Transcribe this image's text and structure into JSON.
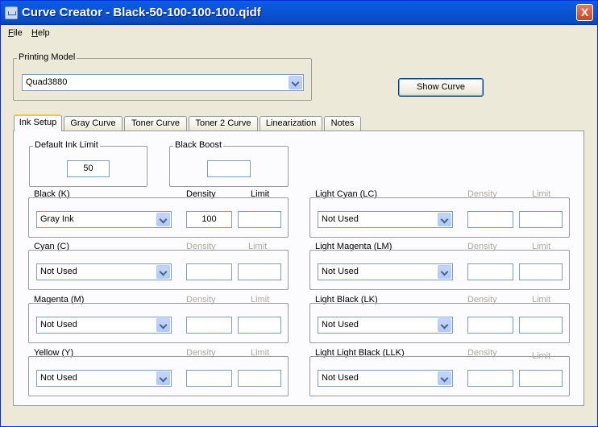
{
  "window": {
    "title": "Curve Creator - Black-50-100-100-100.qidf",
    "close_label": "X"
  },
  "menu": {
    "file_u": "F",
    "file_rest": "ile",
    "help_u": "H",
    "help_rest": "elp"
  },
  "printing_model": {
    "label": "Printing Model",
    "value": "Quad3880"
  },
  "show_curve_label": "Show Curve",
  "tabs": [
    "Ink Setup",
    "Gray Curve",
    "Toner Curve",
    "Toner 2 Curve",
    "Linearization",
    "Notes"
  ],
  "default_ink_limit": {
    "label": "Default Ink Limit",
    "value": "50"
  },
  "black_boost": {
    "label": "Black Boost",
    "value": ""
  },
  "col_headers": {
    "density": "Density",
    "limit": "Limit"
  },
  "inks_left": [
    {
      "name": "Black (K)",
      "value": "Gray Ink",
      "density": "100",
      "limit": ""
    },
    {
      "name": "Cyan (C)",
      "value": "Not Used",
      "density": "",
      "limit": ""
    },
    {
      "name": "Magenta (M)",
      "value": "Not Used",
      "density": "",
      "limit": ""
    },
    {
      "name": "Yellow (Y)",
      "value": "Not Used",
      "density": "",
      "limit": ""
    }
  ],
  "inks_right": [
    {
      "name": "Light Cyan (LC)",
      "value": "Not Used",
      "density": "",
      "limit": ""
    },
    {
      "name": "Light Magenta (LM)",
      "value": "Not Used",
      "density": "",
      "limit": ""
    },
    {
      "name": "Light Black (LK)",
      "value": "Not Used",
      "density": "",
      "limit": ""
    },
    {
      "name": "Light Light Black (LLK)",
      "value": "Not Used",
      "density": "",
      "limit": ""
    }
  ]
}
